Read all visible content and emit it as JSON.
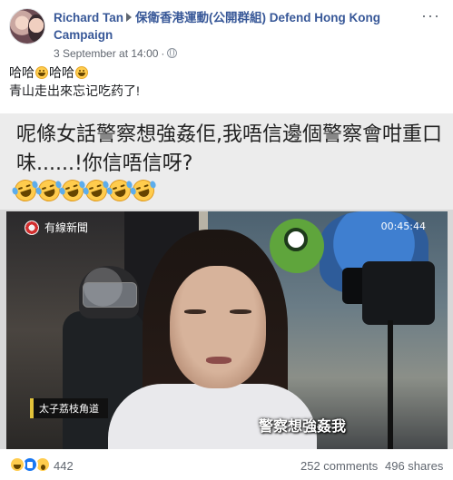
{
  "post": {
    "author": "Richard Tan",
    "group": "保衛香港運動(公開群組) Defend Hong Kong Campaign",
    "date": "3 September at 14:00",
    "separator": "·",
    "more": "···",
    "text_line1_a": "哈哈",
    "text_line1_b": "哈哈",
    "text_line2": "青山走出來忘记吃药了!"
  },
  "image": {
    "caption_line": "呢條女話警察想強姦佢,我唔信邊個警察會咁重口味......!你信唔信呀?",
    "laugh_emoji_count": 6,
    "video": {
      "channel_logo": "有線新聞",
      "timecode": "00:45:44",
      "location": "太子荔枝角道",
      "subtitle": "警察想強姦我"
    }
  },
  "footer": {
    "reaction_count": "442",
    "comments": "252 comments",
    "shares": "496 shares",
    "reactions": [
      "haha-icon",
      "like-icon",
      "wow-icon"
    ]
  },
  "colors": {
    "link": "#385898",
    "meta": "#616770"
  }
}
